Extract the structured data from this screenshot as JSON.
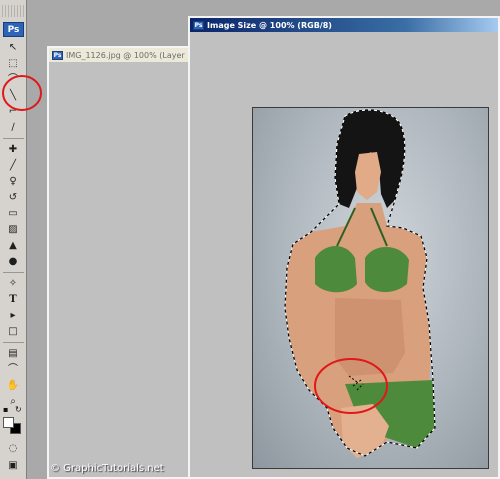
{
  "tools": {
    "logo": "Ps",
    "items": [
      {
        "name": "move-tool",
        "glyph": "↖"
      },
      {
        "name": "marquee-tool",
        "glyph": "⬚"
      },
      {
        "name": "lasso-tool",
        "glyph": "⌒"
      },
      {
        "name": "magic-wand-tool",
        "glyph": "╲"
      },
      {
        "name": "crop-tool",
        "glyph": "⌐"
      },
      {
        "name": "slice-tool",
        "glyph": "∕"
      },
      {
        "name": "healing-brush-tool",
        "glyph": "✚"
      },
      {
        "name": "brush-tool",
        "glyph": "╱"
      },
      {
        "name": "clone-stamp-tool",
        "glyph": "♀"
      },
      {
        "name": "history-brush-tool",
        "glyph": "↺"
      },
      {
        "name": "eraser-tool",
        "glyph": "▭"
      },
      {
        "name": "gradient-tool",
        "glyph": "▨"
      },
      {
        "name": "blur-tool",
        "glyph": "▲"
      },
      {
        "name": "dodge-tool",
        "glyph": "●"
      },
      {
        "name": "pen-tool",
        "glyph": "✧"
      },
      {
        "name": "type-tool",
        "glyph": "T"
      },
      {
        "name": "path-selection-tool",
        "glyph": "▸"
      },
      {
        "name": "shape-tool",
        "glyph": "□"
      },
      {
        "name": "notes-tool",
        "glyph": "▤"
      },
      {
        "name": "eyedropper-tool",
        "glyph": "⌒"
      },
      {
        "name": "hand-tool",
        "glyph": "✋"
      },
      {
        "name": "zoom-tool",
        "glyph": "⌕"
      }
    ],
    "quick_mask_glyph": "◌",
    "screen_mode_glyph": "▣"
  },
  "windows": {
    "back_title": "IMG_1126.jpg @ 100% (Layer 1",
    "front_title": "Image Size @ 100% (RGB/8)"
  },
  "copyright": "© GraphicTutorials.net",
  "colors": {
    "annotation": "#e01818",
    "bikini": "#4e8a3b",
    "skin": "#d9a07e",
    "hair": "#141414",
    "selection": "#ffffff"
  }
}
